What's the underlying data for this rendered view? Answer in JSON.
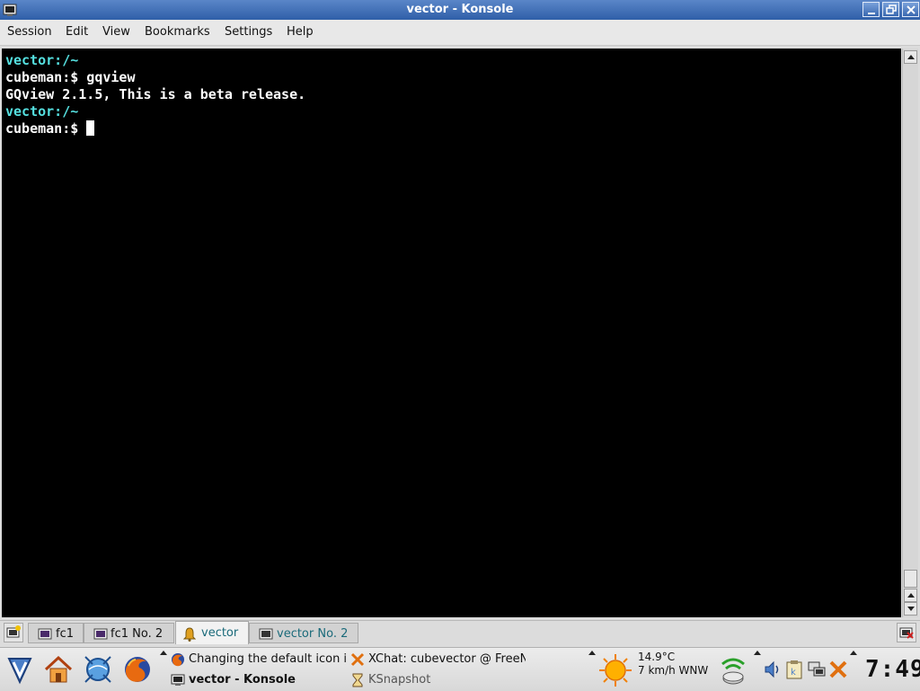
{
  "window": {
    "title": "vector - Konsole",
    "icon": "konsole-icon",
    "controls": [
      "minimize-icon",
      "restore-icon",
      "close-icon"
    ]
  },
  "menubar": {
    "items": [
      "Session",
      "Edit",
      "View",
      "Bookmarks",
      "Settings",
      "Help"
    ]
  },
  "terminal": {
    "lines": [
      {
        "text": "vector:/~",
        "style": "cyan"
      },
      {
        "text": "cubeman:$ gqview",
        "style": "white"
      },
      {
        "text": "GQview 2.1.5, This is a beta release.",
        "style": "white"
      },
      {
        "text": "vector:/~",
        "style": "cyan"
      },
      {
        "text": "cubeman:$ ",
        "style": "white",
        "cursor": true
      }
    ],
    "colors": {
      "background": "#000000",
      "foreground": "#ffffff",
      "prompt_host": "#55e0e0"
    }
  },
  "sessions": {
    "tabs": [
      {
        "label": "fc1",
        "icon": "terminal-icon",
        "active": false
      },
      {
        "label": "fc1 No. 2",
        "icon": "terminal-icon",
        "active": false
      },
      {
        "label": "vector",
        "icon": "bell-icon",
        "active": true
      },
      {
        "label": "vector No. 2",
        "icon": "terminal-icon",
        "active": false
      }
    ],
    "new_session_icon": "new-session-icon",
    "close_session_icon": "close-session-icon"
  },
  "panel": {
    "launchers": [
      "kmenu-icon",
      "home-icon",
      "kde-globe-icon",
      "firefox-icon"
    ],
    "tasks": [
      {
        "label": "Changing the default icon i",
        "icon": "firefox-icon",
        "active": false
      },
      {
        "label": "XChat: cubevector @ FreeN",
        "icon": "xchat-icon",
        "active": false
      },
      {
        "label": "vector - Konsole",
        "icon": "konsole-icon",
        "active": true
      },
      {
        "label": "KSnapshot",
        "icon": "hourglass-icon",
        "active": false
      }
    ],
    "weather": {
      "icon": "sun-icon",
      "temperature": "14.9°C",
      "wind": "7 km/h WNW"
    },
    "tray": [
      "wireless-icon",
      "volume-icon",
      "klipper-icon",
      "network-icon",
      "tools-icon"
    ],
    "clock": "7:49"
  }
}
